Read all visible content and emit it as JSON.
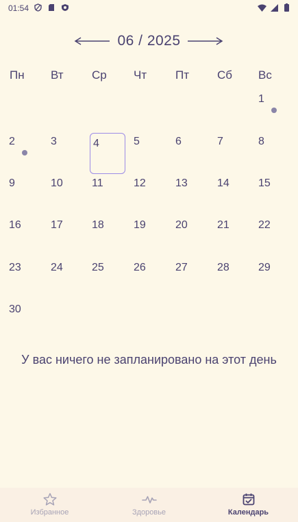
{
  "status_bar": {
    "time": "01:54"
  },
  "calendar": {
    "month_label": "06 / 2025",
    "weekdays": [
      "Пн",
      "Вт",
      "Ср",
      "Чт",
      "Пт",
      "Сб",
      "Вс"
    ],
    "selected_day": "4",
    "days_with_events": [
      "1",
      "2"
    ],
    "days": [
      "1",
      "2",
      "3",
      "4",
      "5",
      "6",
      "7",
      "8",
      "9",
      "10",
      "11",
      "12",
      "13",
      "14",
      "15",
      "16",
      "17",
      "18",
      "19",
      "20",
      "21",
      "22",
      "23",
      "24",
      "25",
      "26",
      "27",
      "28",
      "29",
      "30"
    ]
  },
  "empty_message": "У вас ничего не запланировано на этот день",
  "bottom_nav": {
    "favorites_label": "Избранное",
    "health_label": "Здоровье",
    "calendar_label": "Календарь",
    "active": "calendar"
  },
  "colors": {
    "background": "#fdf8e8",
    "text": "#4a4270",
    "selected_border": "#9c8be6",
    "event_dot": "#8a85a8",
    "nav_bg": "#faf0e4",
    "nav_inactive": "#a7a3b6"
  }
}
